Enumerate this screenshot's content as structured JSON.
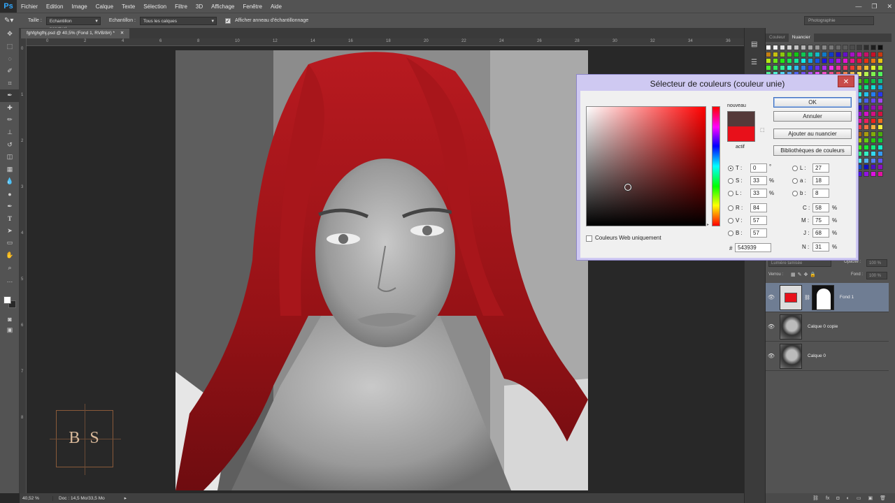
{
  "app": {
    "logo": "Ps"
  },
  "menu": [
    "Fichier",
    "Edition",
    "Image",
    "Calque",
    "Texte",
    "Sélection",
    "Filtre",
    "3D",
    "Affichage",
    "Fenêtre",
    "Aide"
  ],
  "options": {
    "size_label": "Taille :",
    "size_value": "Echantillon ponctuel",
    "sample_label": "Echantillon :",
    "sample_value": "Tous les calques",
    "ring_label": "Afficher anneau d'échantillonnage",
    "ring_checked": true,
    "workspace": "Photographie"
  },
  "document": {
    "tab_title": "fghfghgfhj.psd @ 40,5% (Fond 1, RVB/8#) *",
    "zoom": "40,52 %",
    "doc_info": "Doc : 14,5 Mo/33,5 Mo",
    "ruler_top": [
      "0",
      "2",
      "4",
      "6",
      "8",
      "10",
      "12",
      "14",
      "16",
      "18",
      "20",
      "22",
      "24",
      "26",
      "28",
      "30",
      "32",
      "34",
      "36",
      "38"
    ],
    "ruler_left": [
      "0",
      "1",
      "2",
      "3",
      "4",
      "5",
      "6",
      "7",
      "8"
    ],
    "watermark": "B S"
  },
  "panels": {
    "tabs": [
      "Couleur",
      "Nuancier"
    ],
    "active_tab": "Nuancier",
    "layers": {
      "blend_mode": "Lumière tamisée",
      "opacity_label": "Opacité :",
      "opacity": "100 %",
      "lock_label": "Verrou :",
      "fill_label": "Fond :",
      "fill": "100 %",
      "items": [
        {
          "name": "Fond 1",
          "selected": true
        },
        {
          "name": "Calque 0 copie",
          "selected": false
        },
        {
          "name": "Calque 0",
          "selected": false
        }
      ]
    }
  },
  "picker": {
    "title": "Sélecteur de couleurs (couleur unie)",
    "new_label": "nouveau",
    "current_label": "actif",
    "new_color": "#543939",
    "current_color": "#e8101a",
    "buttons": {
      "ok": "OK",
      "cancel": "Annuler",
      "add_swatch": "Ajouter au nuancier",
      "libraries": "Bibliothèques de couleurs"
    },
    "web_only": "Couleurs Web uniquement",
    "hsb": {
      "T": "0",
      "S": "33",
      "L": "33"
    },
    "rgb": {
      "R": "84",
      "V": "57",
      "B": "57"
    },
    "lab": {
      "L": "27",
      "a": "18",
      "b": "8"
    },
    "cmjn": {
      "C": "58",
      "M": "75",
      "J": "68",
      "N": "31"
    },
    "hex": "543939",
    "degree": "°",
    "pct": "%",
    "hash": "#"
  },
  "colors": {
    "hair": "#9d1418",
    "foreground": "#ffffff",
    "background": "#282828"
  }
}
